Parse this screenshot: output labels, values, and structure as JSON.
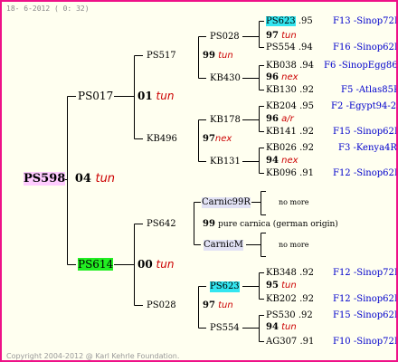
{
  "header": {
    "date": "18- 6-2012 ( 0: 32)"
  },
  "footer": {
    "copyright": "Copyright 2004-2012 @ Karl Kehrle Foundation."
  },
  "colors": {
    "border": "#ee1188",
    "note_red": "#cc0000",
    "origin_blue": "#0000cc",
    "highlight_cyan": "#33e6f0",
    "highlight_green": "#22ee22",
    "highlight_pink": "#ffccff"
  },
  "root": {
    "id": "PS598",
    "year": "04",
    "note": "tun"
  },
  "gen1": {
    "sire": {
      "id": "PS017",
      "year": "01",
      "note": "tun"
    },
    "dam": {
      "id": "PS614",
      "year": "00",
      "note": "tun"
    }
  },
  "gen2": {
    "ps517": {
      "id": "PS517",
      "year": "99",
      "note": "tun"
    },
    "kb496": {
      "id": "KB496",
      "year": "97",
      "note": "nex"
    },
    "ps642": {
      "id": "PS642",
      "year": "99",
      "note": "pure carnica (german origin)"
    },
    "ps028": {
      "id": "PS028",
      "year": "97",
      "note": "tun"
    }
  },
  "gen3": {
    "ps028a": {
      "id": "PS028",
      "year": "97",
      "note": "tun"
    },
    "kb430": {
      "id": "KB430",
      "year": "96",
      "note": "nex"
    },
    "kb178": {
      "id": "KB178",
      "year": "96",
      "note": "a/r"
    },
    "kb131": {
      "id": "KB131",
      "year": "94",
      "note": "nex"
    },
    "carnic99r": {
      "id": "Carnic99R",
      "note": "no more"
    },
    "carnicm": {
      "id": "CarnicM",
      "note": "no more"
    },
    "ps623": {
      "id": "PS623",
      "year": "95",
      "note": "tun"
    },
    "ps554": {
      "id": "PS554",
      "year": "94",
      "note": "tun"
    }
  },
  "gen4": [
    {
      "id": "PS623",
      "year": ".95",
      "origin": "F13 -Sinop72R"
    },
    {
      "id": "PS554",
      "year": ".94",
      "origin": "F16 -Sinop62R"
    },
    {
      "id": "KB038",
      "year": ".94",
      "origin": "F6 -SinopEgg86R"
    },
    {
      "id": "KB130",
      "year": ".92",
      "origin": "F5 -Atlas85R"
    },
    {
      "id": "KB204",
      "year": ".95",
      "origin": "F2 -Egypt94-2R"
    },
    {
      "id": "KB141",
      "year": ".92",
      "origin": "F15 -Sinop62R"
    },
    {
      "id": "KB026",
      "year": ".92",
      "origin": "F3 -Kenya4R"
    },
    {
      "id": "KB096",
      "year": ".91",
      "origin": "F12 -Sinop62R"
    },
    {
      "id": "KB348",
      "year": ".92",
      "origin": "F12 -Sinop72R"
    },
    {
      "id": "KB202",
      "year": ".92",
      "origin": "F12 -Sinop62R"
    },
    {
      "id": "PS530",
      "year": ".92",
      "origin": "F15 -Sinop62R"
    },
    {
      "id": "AG307",
      "year": ".91",
      "origin": "F10 -Sinop72R"
    }
  ]
}
